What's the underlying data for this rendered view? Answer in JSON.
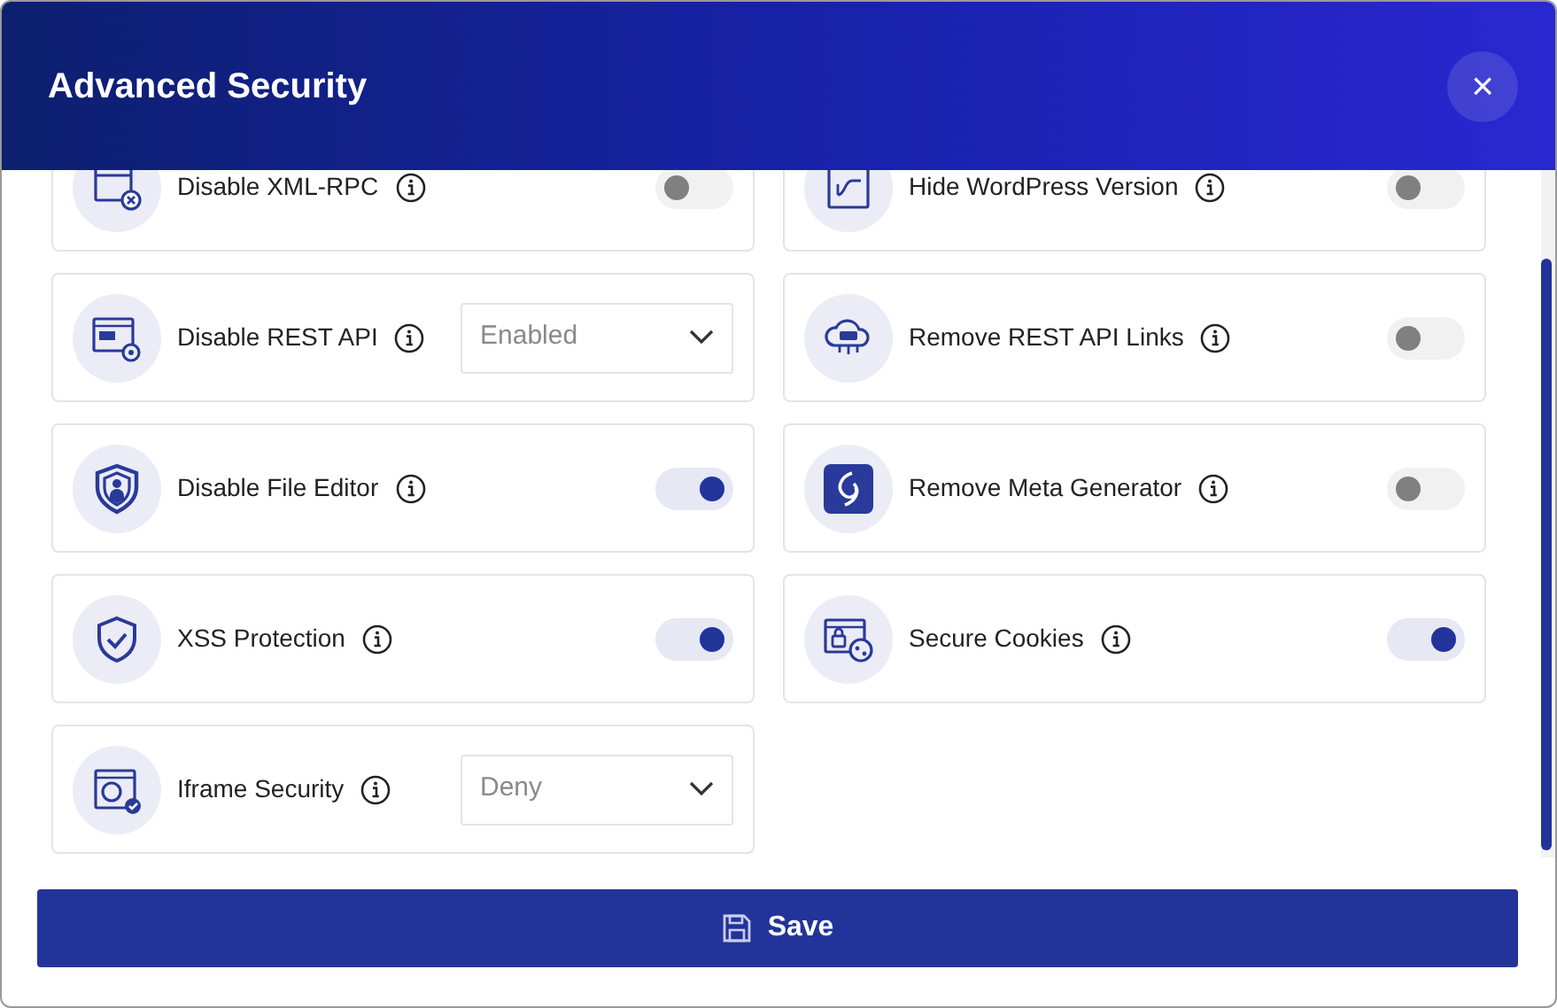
{
  "dialog": {
    "title": "Advanced Security",
    "close": "×"
  },
  "settings": [
    {
      "label": "Disable XML-RPC",
      "kind": "toggle",
      "on": false
    },
    {
      "label": "Hide WordPress Version",
      "kind": "toggle",
      "on": false
    },
    {
      "label": "Disable REST API",
      "kind": "select",
      "value": "Enabled"
    },
    {
      "label": "Remove REST API Links",
      "kind": "toggle",
      "on": false
    },
    {
      "label": "Disable File Editor",
      "kind": "toggle",
      "on": true
    },
    {
      "label": "Remove Meta Generator",
      "kind": "toggle",
      "on": false
    },
    {
      "label": "XSS Protection",
      "kind": "toggle",
      "on": true
    },
    {
      "label": "Secure Cookies",
      "kind": "toggle",
      "on": true
    },
    {
      "label": "Iframe Security",
      "kind": "select",
      "value": "Deny"
    }
  ],
  "save_button": "Save"
}
